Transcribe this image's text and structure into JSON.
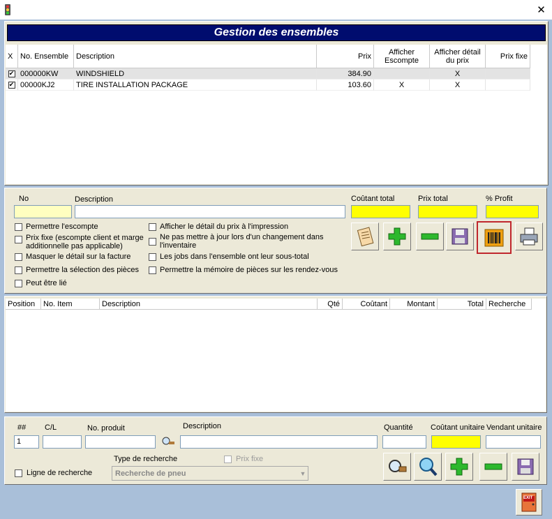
{
  "window": {
    "close_glyph": "✕"
  },
  "header": {
    "title": "Gestion des ensembles"
  },
  "ensembles_grid": {
    "columns": [
      "X",
      "No. Ensemble",
      "Description",
      "Prix",
      "Afficher Escompte",
      "Afficher détail du prix",
      "Prix fixe"
    ],
    "rows": [
      {
        "checked": true,
        "no": "000000KW",
        "description": "WINDSHIELD",
        "prix": "384.90",
        "escompte": "",
        "detail": "X",
        "fixe": ""
      },
      {
        "checked": true,
        "no": "00000KJ2",
        "description": "TIRE INSTALLATION PACKAGE",
        "prix": "103.60",
        "escompte": "X",
        "detail": "X",
        "fixe": ""
      }
    ]
  },
  "ensemble_form": {
    "no_label": "No",
    "description_label": "Description",
    "coutant_total_label": "Coûtant total",
    "prix_total_label": "Prix total",
    "profit_label": "% Profit",
    "no_value": "",
    "description_value": "",
    "options_left": [
      "Permettre l'escompte",
      "Prix fixe (escompte client et marge additionnelle  pas applicable)",
      "Masquer le détail sur la facture",
      "Permettre la sélection des pièces",
      "Peut être lié"
    ],
    "options_right": [
      "Afficher le détail du prix à l'impression",
      "Ne pas mettre à jour lors d'un changement dans l'inventaire",
      "Les jobs dans l'ensemble ont leur sous-total",
      "Permettre la mémoire de pièces sur les rendez-vous"
    ],
    "toolbar_icons": [
      "notepad-icon",
      "add-icon",
      "remove-icon",
      "save-icon",
      "barcode-icon",
      "print-icon"
    ]
  },
  "items_grid": {
    "columns": [
      "Position",
      "No. Item",
      "Description",
      "Qté",
      "Coûtant",
      "Montant",
      "Total",
      "Recherche"
    ]
  },
  "item_form": {
    "num_label": "##",
    "cl_label": "C/L",
    "produit_label": "No. produit",
    "description_label": "Description",
    "quantite_label": "Quantité",
    "coutant_label": "Coûtant unitaire",
    "vendant_label": "Vendant unitaire",
    "num_value": "1",
    "ligne_recherche_label": "Ligne de recherche",
    "type_recherche_label": "Type de recherche",
    "prix_fixe_label": "Prix fixe",
    "type_recherche_value": "Recherche de pneu",
    "toolbar_icons": [
      "search-part-icon",
      "zoom-icon",
      "add-icon",
      "remove-icon",
      "save-icon"
    ]
  },
  "exit_label": "EXIT",
  "colors": {
    "header_band": "#000c6e",
    "highlight": "#ffff00",
    "add_green": "#2db82d",
    "selected_border": "#c0272d"
  }
}
